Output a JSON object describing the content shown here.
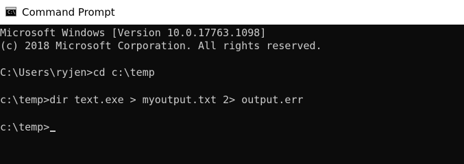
{
  "window": {
    "title": "Command Prompt",
    "icon": "command-prompt-icon",
    "icon_glyph": "C:\\"
  },
  "console": {
    "background": "#0c0c0c",
    "text_color": "#cccccc",
    "lines": [
      "Microsoft Windows [Version 10.0.17763.1098]",
      "(c) 2018 Microsoft Corporation. All rights reserved.",
      "C:\\Users\\ryjen>cd c:\\temp",
      "c:\\temp>dir text.exe > myoutput.txt 2> output.err",
      "c:\\temp>"
    ]
  }
}
